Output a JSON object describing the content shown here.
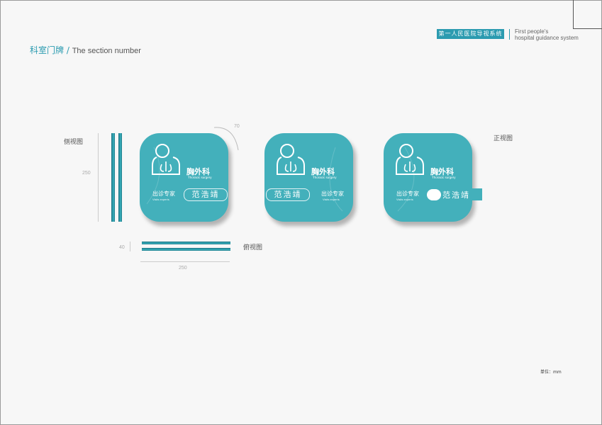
{
  "header": {
    "hospital_cn": "第一人民医院导视系统",
    "hospital_en_line1": "First people's",
    "hospital_en_line2": "hospital guidance system"
  },
  "page": {
    "title_cn": "科室门牌 /",
    "title_en": "The section number"
  },
  "views": {
    "side": "侧视图",
    "top": "俯视图",
    "front": "正视图"
  },
  "dimensions": {
    "height": "250",
    "depth": "40",
    "width": "250",
    "radius": "70"
  },
  "sign": {
    "dept_cn": "胸外科",
    "dept_en": "Thoracic surgery",
    "experts_cn": "出诊专家",
    "experts_en": "Visits experts",
    "doctor": "范浩靖"
  },
  "unit_label": "单位：mm",
  "colors": {
    "teal": "#43b0bb",
    "brand": "#2b9bb0",
    "dark_teal": "#1b6f80"
  }
}
